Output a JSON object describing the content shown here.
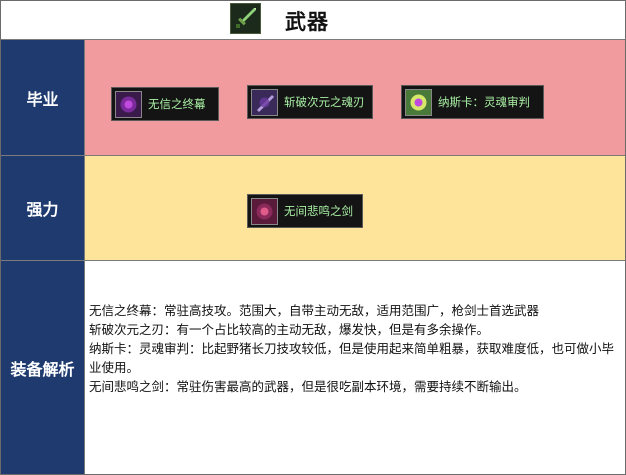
{
  "header": {
    "title": "武器",
    "icon": "sword-icon"
  },
  "rows": {
    "graduation": {
      "label": "毕业",
      "items": [
        {
          "name": "无信之终幕",
          "icon": "weapon-icon",
          "icon_color": "#3a1a4a"
        },
        {
          "name": "斩破次元之魂刃",
          "icon": "weapon-icon",
          "icon_color": "#3a2a5a"
        },
        {
          "name": "纳斯卡：灵魂审判",
          "icon": "weapon-icon",
          "icon_color": "#4a7a3a"
        }
      ]
    },
    "strong": {
      "label": "强力",
      "items": [
        {
          "name": "无间悲鸣之剑",
          "icon": "weapon-icon",
          "icon_color": "#5a1a3a"
        }
      ]
    },
    "analysis": {
      "label": "装备解析",
      "lines": [
        "无信之终幕：常驻高技攻。范围大，自带主动无敌，适用范围广，枪剑士首选武器",
        "斩破次元之刃：有一个占比较高的主动无敌，爆发快，但是有多余操作。",
        "纳斯卡：灵魂审判：比起野猪长刀技攻较低，但是使用起来简单粗暴，获取难度低，也可做小毕业使用。",
        "无间悲鸣之剑：常驻伤害最高的武器，但是很吃副本环境，需要持续不断输出。"
      ]
    }
  },
  "colors": {
    "label_bg": "#1e3a6e",
    "graduation_bg": "#f29b9f",
    "strong_bg": "#fde49a",
    "item_text": "#a9f0a4"
  }
}
